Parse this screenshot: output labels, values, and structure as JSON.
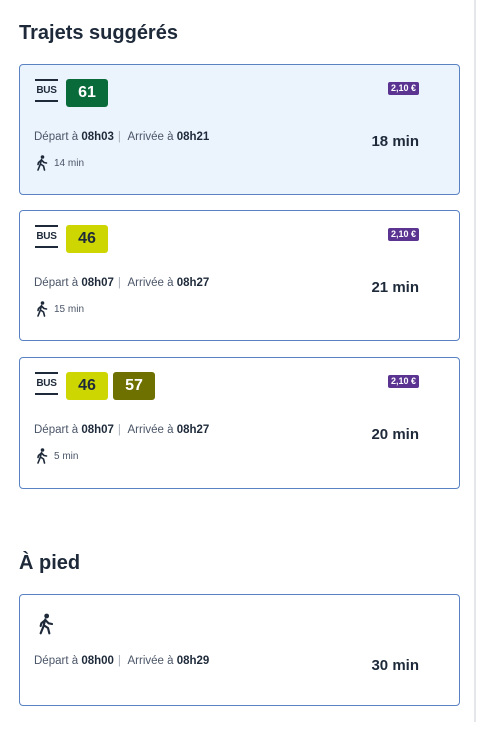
{
  "suggested": {
    "title": "Trajets suggérés",
    "routes": [
      {
        "mode_label": "BUS",
        "lines": [
          {
            "number": "61",
            "bg": "#0a6b3a",
            "fg": "#ffffff"
          }
        ],
        "price": "2,10 €",
        "depart_label": "Départ à",
        "depart_time": "08h03",
        "arrive_label": "Arrivée à",
        "arrive_time": "08h21",
        "duration": "18 min",
        "walk": "14 min",
        "selected": true
      },
      {
        "mode_label": "BUS",
        "lines": [
          {
            "number": "46",
            "bg": "#cdd600",
            "fg": "#1e2a3a"
          }
        ],
        "price": "2,10 €",
        "depart_label": "Départ à",
        "depart_time": "08h07",
        "arrive_label": "Arrivée à",
        "arrive_time": "08h27",
        "duration": "21 min",
        "walk": "15 min",
        "selected": false
      },
      {
        "mode_label": "BUS",
        "lines": [
          {
            "number": "46",
            "bg": "#cdd600",
            "fg": "#1e2a3a"
          },
          {
            "number": "57",
            "bg": "#6e7000",
            "fg": "#ffffff"
          }
        ],
        "price": "2,10 €",
        "depart_label": "Départ à",
        "depart_time": "08h07",
        "arrive_label": "Arrivée à",
        "arrive_time": "08h27",
        "duration": "20 min",
        "walk": "5 min",
        "selected": false
      }
    ]
  },
  "on_foot": {
    "title": "À pied",
    "icon": "walking-person-icon",
    "depart_label": "Départ à",
    "depart_time": "08h00",
    "arrive_label": "Arrivée à",
    "arrive_time": "08h29",
    "duration": "30 min"
  },
  "colors": {
    "card_border": "#5a82c2",
    "selected_bg": "#ebf3fd",
    "price_badge": "#5b3491",
    "text": "#1e2a3a"
  }
}
